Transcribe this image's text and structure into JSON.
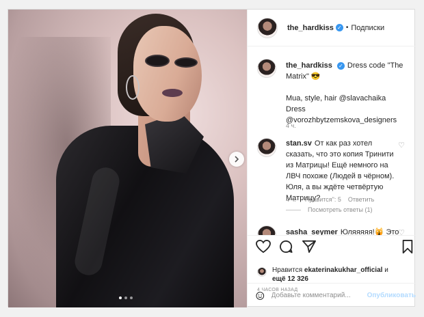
{
  "post": {
    "username": "the_hardkiss",
    "follow_state": "Подписки",
    "separator": "•",
    "verified_mark": "✓"
  },
  "caption": {
    "username": "the_hardkiss",
    "text": "Dress code \"The Matrix\" 😎",
    "line2": "Mua, style, hair @slavachaika",
    "line3": "Dress @vorozhbytzemskova_designers",
    "age": "4 ч."
  },
  "comments": [
    {
      "username": "stan.sv",
      "text": "От как раз хотел сказать, что это копия Тринити из Матрицы! Ещё немного на ЛВЧ похоже (Людей в чёрном). Юля, а вы ждёте четвёртую Матрицу?",
      "age": "4 ч.",
      "likes": "\"Нравится\": 5",
      "reply_label": "Ответить",
      "view_replies": "Посмотреть ответы (1)"
    },
    {
      "username": "sasha_seymer",
      "text": "Юляяяяя!🙀 Это"
    }
  ],
  "likes": {
    "prefix": "Нравится",
    "user": "ekaterinakukhar_official",
    "joiner": "и",
    "rest": "ещё 12 326"
  },
  "timestamp": "4 ЧАСОВ НАЗАД",
  "comment_input": {
    "placeholder": "Добавьте комментарий...",
    "publish_label": "Опубликовать"
  },
  "icons": {
    "heart": "heart-icon",
    "comment": "comment-icon",
    "share": "share-icon",
    "save": "bookmark-icon",
    "emoji": "emoji-icon",
    "next": "chevron-right-icon"
  },
  "colors": {
    "accent": "#3897f0",
    "publish_disabled": "#b3dbff",
    "muted": "#8e8e8e"
  },
  "carousel": {
    "total_slides": 3,
    "active_slide": 1
  }
}
